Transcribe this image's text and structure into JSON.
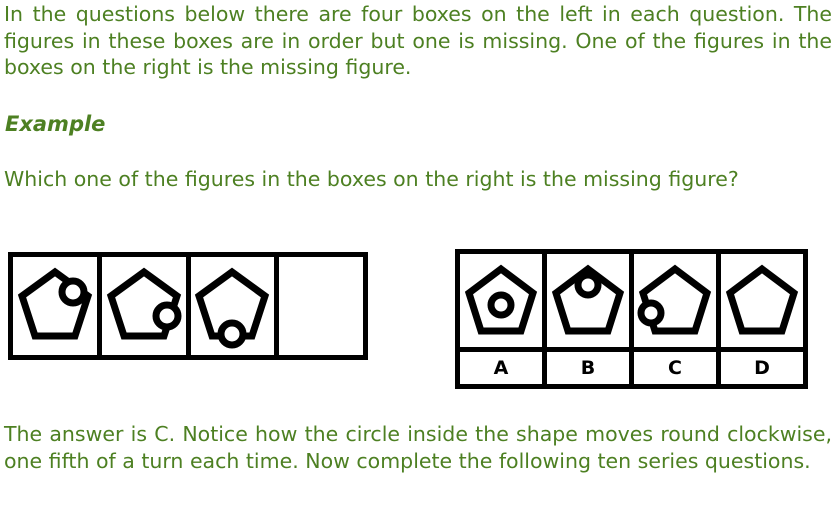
{
  "text": {
    "intro": "In the questions below there are four boxes on the left in each question. The figures in these boxes are in order but one is missing. One of the figures in the boxes on the right is the missing figure.",
    "example_heading": "Example",
    "question": "Which one of the figures in the boxes on the right is the missing figure?",
    "explanation": "The answer is C. Notice how the circle inside the shape moves round clockwise, one fifth of a turn each time. Now complete the following ten series questions."
  },
  "colors": {
    "text_green": "#4d8022",
    "figure_black": "#000000",
    "background": "#ffffff"
  },
  "series": {
    "name": "pentagon-with-rotating-circle",
    "shape": "pentagon",
    "rule": "circle moves clockwise one fifth of a turn each step",
    "left_boxes": [
      {
        "id": "series-box-1",
        "figure": "pentagon-circle-upper-right",
        "circle_angle_deg": 36,
        "has_circle": true
      },
      {
        "id": "series-box-2",
        "figure": "pentagon-circle-lower-right",
        "circle_angle_deg": 108,
        "has_circle": true
      },
      {
        "id": "series-box-3",
        "figure": "pentagon-circle-bottom",
        "circle_angle_deg": 180,
        "has_circle": true
      },
      {
        "id": "series-box-4",
        "figure": "empty",
        "circle_angle_deg": null,
        "has_circle": false
      }
    ],
    "answer_boxes": [
      {
        "label": "A",
        "figure": "pentagon-circle-center",
        "circle_angle_deg": null,
        "has_circle": true,
        "position": "center"
      },
      {
        "label": "B",
        "figure": "pentagon-circle-top",
        "circle_angle_deg": 0,
        "has_circle": true,
        "position": "vertex"
      },
      {
        "label": "C",
        "figure": "pentagon-circle-lower-left",
        "circle_angle_deg": 252,
        "has_circle": true,
        "position": "vertex"
      },
      {
        "label": "D",
        "figure": "pentagon-no-circle",
        "circle_angle_deg": null,
        "has_circle": false,
        "position": "none"
      }
    ],
    "correct_answer": "C"
  }
}
